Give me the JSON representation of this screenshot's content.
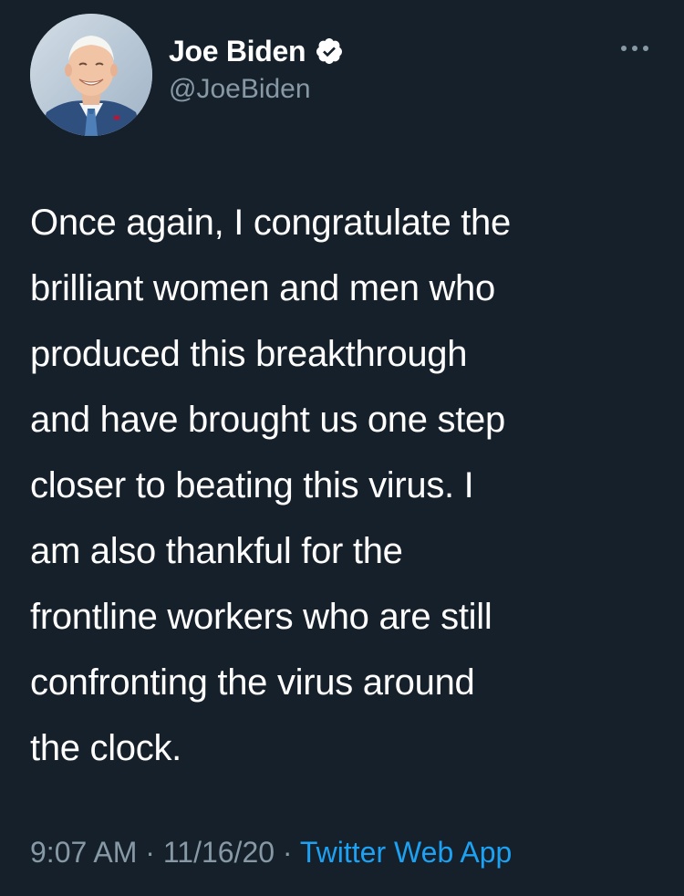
{
  "author": {
    "display_name": "Joe Biden",
    "handle": "@JoeBiden",
    "verified": true
  },
  "tweet": {
    "text": "Once again, I congratulate the\nbrilliant women and men who\nproduced this breakthrough\nand have brought us one step\ncloser to beating this virus. I\nam also thankful for the\nfrontline workers who are still\nconfronting the virus around\nthe clock."
  },
  "meta": {
    "time": "9:07 AM",
    "separator": "·",
    "date": "11/16/20",
    "source": "Twitter Web App"
  },
  "icons": {
    "avatar": "avatar-photo",
    "verified": "verified-badge-icon",
    "more": "more-options-icon"
  },
  "colors": {
    "background": "#15202b",
    "text": "#ffffff",
    "secondary_text": "#8899a6",
    "link": "#1da1f2"
  }
}
